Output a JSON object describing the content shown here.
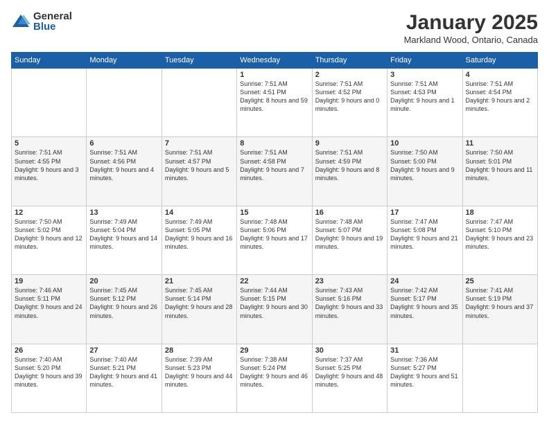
{
  "header": {
    "logo_general": "General",
    "logo_blue": "Blue",
    "month_title": "January 2025",
    "location": "Markland Wood, Ontario, Canada"
  },
  "days_of_week": [
    "Sunday",
    "Monday",
    "Tuesday",
    "Wednesday",
    "Thursday",
    "Friday",
    "Saturday"
  ],
  "weeks": [
    [
      {
        "day": "",
        "text": ""
      },
      {
        "day": "",
        "text": ""
      },
      {
        "day": "",
        "text": ""
      },
      {
        "day": "1",
        "text": "Sunrise: 7:51 AM\nSunset: 4:51 PM\nDaylight: 8 hours and 59 minutes."
      },
      {
        "day": "2",
        "text": "Sunrise: 7:51 AM\nSunset: 4:52 PM\nDaylight: 9 hours and 0 minutes."
      },
      {
        "day": "3",
        "text": "Sunrise: 7:51 AM\nSunset: 4:53 PM\nDaylight: 9 hours and 1 minute."
      },
      {
        "day": "4",
        "text": "Sunrise: 7:51 AM\nSunset: 4:54 PM\nDaylight: 9 hours and 2 minutes."
      }
    ],
    [
      {
        "day": "5",
        "text": "Sunrise: 7:51 AM\nSunset: 4:55 PM\nDaylight: 9 hours and 3 minutes."
      },
      {
        "day": "6",
        "text": "Sunrise: 7:51 AM\nSunset: 4:56 PM\nDaylight: 9 hours and 4 minutes."
      },
      {
        "day": "7",
        "text": "Sunrise: 7:51 AM\nSunset: 4:57 PM\nDaylight: 9 hours and 5 minutes."
      },
      {
        "day": "8",
        "text": "Sunrise: 7:51 AM\nSunset: 4:58 PM\nDaylight: 9 hours and 7 minutes."
      },
      {
        "day": "9",
        "text": "Sunrise: 7:51 AM\nSunset: 4:59 PM\nDaylight: 9 hours and 8 minutes."
      },
      {
        "day": "10",
        "text": "Sunrise: 7:50 AM\nSunset: 5:00 PM\nDaylight: 9 hours and 9 minutes."
      },
      {
        "day": "11",
        "text": "Sunrise: 7:50 AM\nSunset: 5:01 PM\nDaylight: 9 hours and 11 minutes."
      }
    ],
    [
      {
        "day": "12",
        "text": "Sunrise: 7:50 AM\nSunset: 5:02 PM\nDaylight: 9 hours and 12 minutes."
      },
      {
        "day": "13",
        "text": "Sunrise: 7:49 AM\nSunset: 5:04 PM\nDaylight: 9 hours and 14 minutes."
      },
      {
        "day": "14",
        "text": "Sunrise: 7:49 AM\nSunset: 5:05 PM\nDaylight: 9 hours and 16 minutes."
      },
      {
        "day": "15",
        "text": "Sunrise: 7:48 AM\nSunset: 5:06 PM\nDaylight: 9 hours and 17 minutes."
      },
      {
        "day": "16",
        "text": "Sunrise: 7:48 AM\nSunset: 5:07 PM\nDaylight: 9 hours and 19 minutes."
      },
      {
        "day": "17",
        "text": "Sunrise: 7:47 AM\nSunset: 5:08 PM\nDaylight: 9 hours and 21 minutes."
      },
      {
        "day": "18",
        "text": "Sunrise: 7:47 AM\nSunset: 5:10 PM\nDaylight: 9 hours and 23 minutes."
      }
    ],
    [
      {
        "day": "19",
        "text": "Sunrise: 7:46 AM\nSunset: 5:11 PM\nDaylight: 9 hours and 24 minutes."
      },
      {
        "day": "20",
        "text": "Sunrise: 7:45 AM\nSunset: 5:12 PM\nDaylight: 9 hours and 26 minutes."
      },
      {
        "day": "21",
        "text": "Sunrise: 7:45 AM\nSunset: 5:14 PM\nDaylight: 9 hours and 28 minutes."
      },
      {
        "day": "22",
        "text": "Sunrise: 7:44 AM\nSunset: 5:15 PM\nDaylight: 9 hours and 30 minutes."
      },
      {
        "day": "23",
        "text": "Sunrise: 7:43 AM\nSunset: 5:16 PM\nDaylight: 9 hours and 33 minutes."
      },
      {
        "day": "24",
        "text": "Sunrise: 7:42 AM\nSunset: 5:17 PM\nDaylight: 9 hours and 35 minutes."
      },
      {
        "day": "25",
        "text": "Sunrise: 7:41 AM\nSunset: 5:19 PM\nDaylight: 9 hours and 37 minutes."
      }
    ],
    [
      {
        "day": "26",
        "text": "Sunrise: 7:40 AM\nSunset: 5:20 PM\nDaylight: 9 hours and 39 minutes."
      },
      {
        "day": "27",
        "text": "Sunrise: 7:40 AM\nSunset: 5:21 PM\nDaylight: 9 hours and 41 minutes."
      },
      {
        "day": "28",
        "text": "Sunrise: 7:39 AM\nSunset: 5:23 PM\nDaylight: 9 hours and 44 minutes."
      },
      {
        "day": "29",
        "text": "Sunrise: 7:38 AM\nSunset: 5:24 PM\nDaylight: 9 hours and 46 minutes."
      },
      {
        "day": "30",
        "text": "Sunrise: 7:37 AM\nSunset: 5:25 PM\nDaylight: 9 hours and 48 minutes."
      },
      {
        "day": "31",
        "text": "Sunrise: 7:36 AM\nSunset: 5:27 PM\nDaylight: 9 hours and 51 minutes."
      },
      {
        "day": "",
        "text": ""
      }
    ]
  ]
}
